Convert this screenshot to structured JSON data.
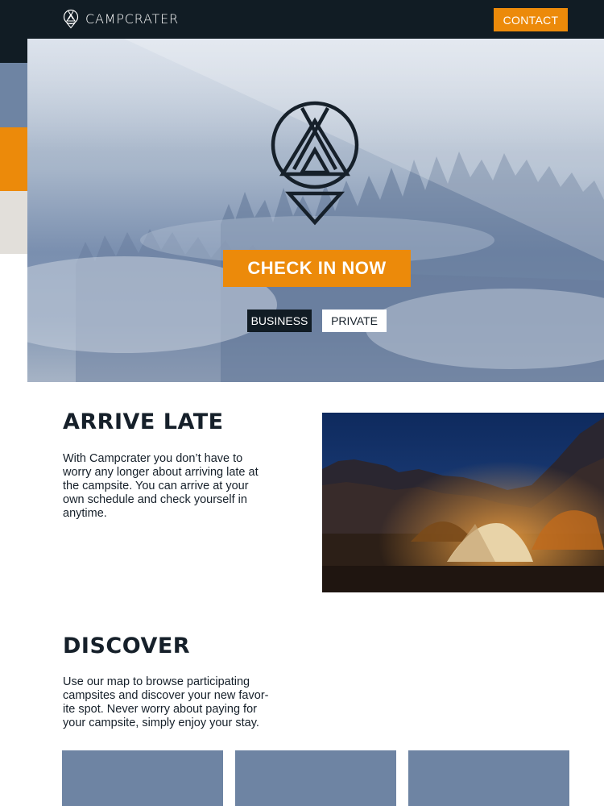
{
  "header": {
    "brand_name": "CAMPCRATER",
    "contact_label": "CONTACT"
  },
  "hero": {
    "checkin_label": "CHECK IN NOW",
    "modes": [
      "BUSINESS",
      "PRIVATE"
    ],
    "selected_mode": "BUSINESS"
  },
  "sections": {
    "arrive": {
      "title": "ARRIVE LATE",
      "lines": [
        "With Campcrater you don’t have to",
        "worry any longer about arriving late at",
        "the campsite. You can arrive at your",
        "own schedule and check yourself in",
        "anytime."
      ]
    },
    "discover": {
      "title": "DISCOVER",
      "lines": [
        "Use our map to browse participating",
        "campsites and discover your new favor-",
        "ite spot. Never worry about paying for",
        "your campsite, simply enjoy your stay."
      ]
    }
  },
  "colors": {
    "dark": "#111c24",
    "accent": "#ec8a0a",
    "slate": "#6e84a3",
    "sand": "#e2dfda"
  },
  "icons": [
    "campcrater-logo",
    "tent-pin-icon"
  ]
}
